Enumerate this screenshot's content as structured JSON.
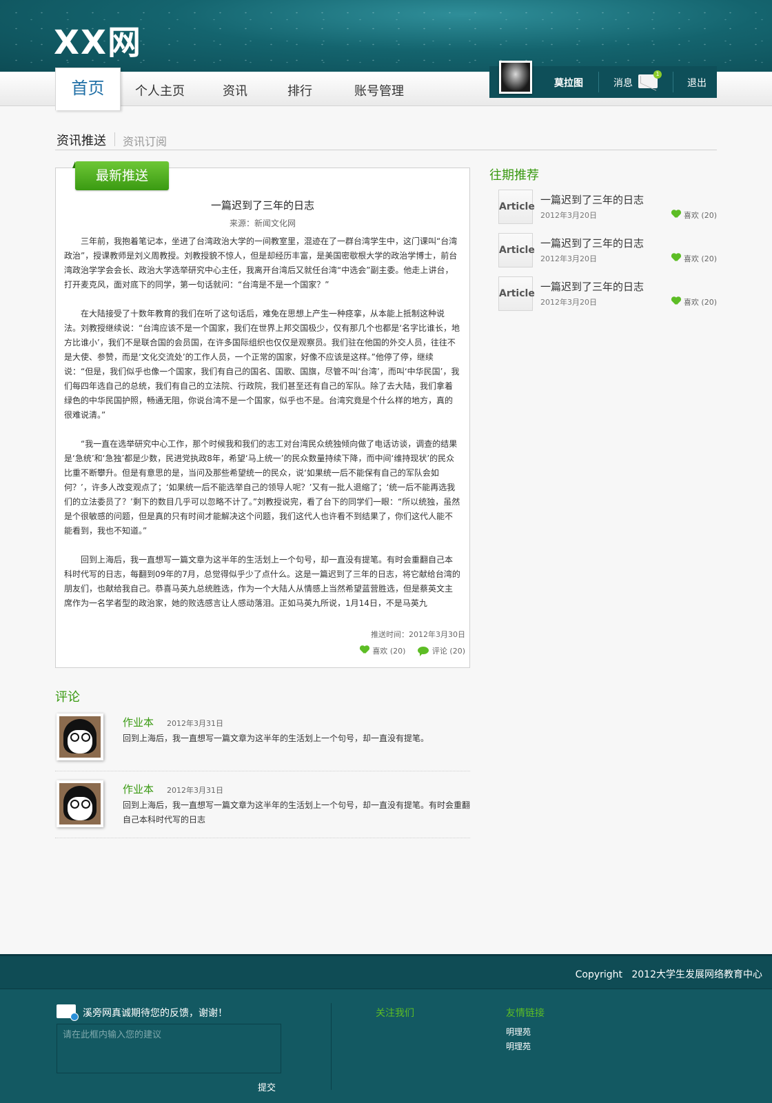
{
  "header": {
    "logo": "XX网",
    "nav": [
      {
        "label": "首页",
        "active": true
      },
      {
        "label": "个人主页"
      },
      {
        "label": "资讯"
      },
      {
        "label": "排行"
      },
      {
        "label": "账号管理"
      }
    ],
    "user": {
      "name": "莫拉图",
      "messages_label": "消息",
      "message_count": "1",
      "logout_label": "退出"
    }
  },
  "subtabs": {
    "active": "资讯推送",
    "other": "资讯订阅"
  },
  "article": {
    "badge": "最新推送",
    "title": "一篇迟到了三年的日志",
    "source": "来源：新闻文化网",
    "paragraphs": [
      "三年前，我抱着笔记本，坐进了台湾政治大学的一间教室里，混迹在了一群台湾学生中，这门课叫“台湾政治”，授课教师是刘义周教授。刘教授貌不惊人，但是却经历丰富，是美国密歇根大学的政治学博士，前台湾政治学学会会长、政治大学选举研究中心主任，我离开台湾后又就任台湾“中选会”副主委。他走上讲台，打开麦克风，面对底下的同学，第一句话就问：“台湾是不是一个国家？”",
      "在大陆接受了十数年教育的我们在听了这句话后，难免在思想上产生一种痉挛，从本能上抵制这种说法。刘教授继续说：“台湾应该不是一个国家，我们在世界上邦交国极少，仅有那几个也都是‘名字比谁长，地方比谁小’，我们不是联合国的会员国，在许多国际组织也仅仅是观察员。我们驻在他国的外交人员，往往不是大使、参赞，而是‘文化交流处’的工作人员，一个正常的国家，好像不应该是这样。”他停了停，继续说：“但是，我们似乎也像一个国家，我们有自己的国名、国歌、国旗，尽管不叫‘台湾’，而叫‘中华民国’，我们每四年选自己的总统，我们有自己的立法院、行政院，我们甚至还有自己的军队。除了去大陆，我们拿着绿色的中华民国护照，畅通无阻，你说台湾不是一个国家，似乎也不是。台湾究竟是个什么样的地方，真的很难说清。”",
      "“我一直在选举研究中心工作，那个时候我和我们的志工对台湾民众统独倾向做了电话访谈，调查的结果是‘急统’和‘急独’都是少数，民进党执政8年，希望‘马上统一’的民众数量持续下降，而中间‘维持现状’的民众比重不断攀升。但是有意思的是，当问及那些希望统一的民众，说‘如果统一后不能保有自己的军队会如何？’，许多人改变观点了；‘如果统一后不能选举自己的领导人呢？’又有一批人退缩了；‘统一后不能再选我们的立法委员了？’剩下的数目几乎可以忽略不计了。”刘教授说完，看了台下的同学们一眼：“所以统独，虽然是个很敏感的问题，但是真的只有时间才能解决这个问题，我们这代人也许看不到结果了，你们这代人能不能看到，我也不知道。”",
      "回到上海后，我一直想写一篇文章为这半年的生活划上一个句号，却一直没有提笔。有时会重翻自己本科时代写的日志，每翻到09年的7月，总觉得似乎少了点什么。这是一篇迟到了三年的日志，将它献给台湾的朋友们，也献给我自己。恭喜马英九总统胜选，作为一个大陆人从情感上当然希望蓝营胜选，但是蔡英文主席作为一名学者型的政治家，她的败选感言让人感动落泪。正如马英九所说，1月14日，不是马英九"
    ],
    "push_time": "推送时间：2012年3月30日",
    "like_label": "喜欢",
    "like_count": "(20)",
    "comment_label": "评论",
    "comment_count": "(20)"
  },
  "sidebar": {
    "title": "往期推荐",
    "items": [
      {
        "thumb": "Article",
        "title": "一篇迟到了三年的日志",
        "date": "2012年3月20日",
        "like_label": "喜欢",
        "like_count": "(20)"
      },
      {
        "thumb": "Article",
        "title": "一篇迟到了三年的日志",
        "date": "2012年3月20日",
        "like_label": "喜欢",
        "like_count": "(20)"
      },
      {
        "thumb": "Article",
        "title": "一篇迟到了三年的日志",
        "date": "2012年3月20日",
        "like_label": "喜欢",
        "like_count": "(20)"
      }
    ]
  },
  "comments": {
    "title": "评论",
    "items": [
      {
        "name": "作业本",
        "date": "2012年3月31日",
        "text": "回到上海后，我一直想写一篇文章为这半年的生活划上一个句号，却一直没有提笔。"
      },
      {
        "name": "作业本",
        "date": "2012年3月31日",
        "text": "回到上海后，我一直想写一篇文章为这半年的生活划上一个句号，却一直没有提笔。有时会重翻自己本科时代写的日志"
      }
    ]
  },
  "footer": {
    "copyright": "Copyright   2012大学生发展网络教育中心",
    "feedback_text": "溪旁网真诚期待您的反馈，谢谢！",
    "feedback_placeholder": "请在此框内输入您的建议",
    "submit_label": "提交",
    "follow_title": "关注我们",
    "links_title": "友情链接",
    "links": [
      "明理苑",
      "明理苑"
    ]
  },
  "colors": {
    "header_teal": "#14646e",
    "accent_green": "#3a9a12",
    "nav_blue": "#1f6fa6",
    "footer_teal": "#135962"
  }
}
